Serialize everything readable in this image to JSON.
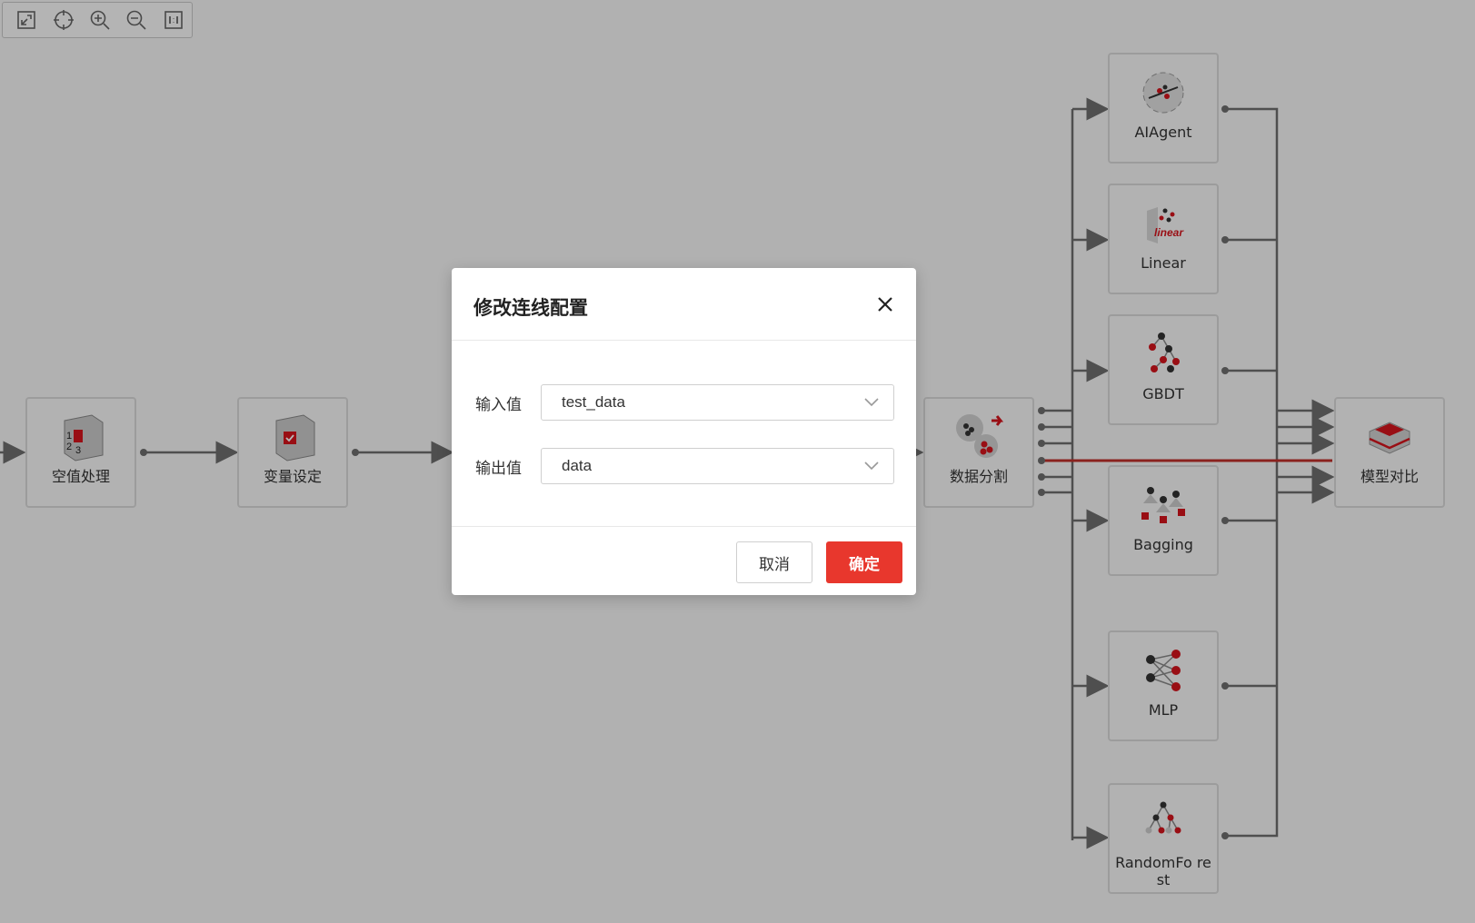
{
  "toolbar": {
    "tools": [
      "fit-view-icon",
      "center-target-icon",
      "zoom-in-icon",
      "zoom-out-icon",
      "actual-size-icon"
    ]
  },
  "nodes": {
    "null_handling": {
      "label": "空值处理"
    },
    "variable_setting": {
      "label": "变量设定"
    },
    "data_split": {
      "label": "数据分割"
    },
    "aiagent": {
      "label": "AIAgent"
    },
    "linear": {
      "label": "Linear"
    },
    "gbdt": {
      "label": "GBDT"
    },
    "bagging": {
      "label": "Bagging"
    },
    "mlp": {
      "label": "MLP"
    },
    "randomforest": {
      "label": "RandomFo rest"
    },
    "model_compare": {
      "label": "模型对比"
    }
  },
  "modal": {
    "title": "修改连线配置",
    "input_label": "输入值",
    "input_value": "test_data",
    "output_label": "输出值",
    "output_value": "data",
    "cancel_label": "取消",
    "ok_label": "确定"
  },
  "colors": {
    "accent": "#e8372d",
    "edge": "#6e6e6e",
    "highlight_edge": "#c0302a"
  }
}
